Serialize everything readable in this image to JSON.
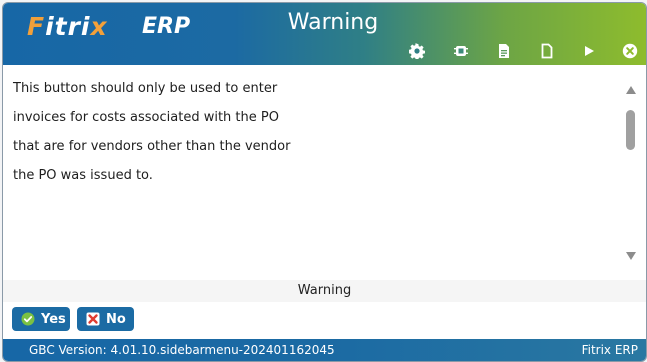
{
  "header": {
    "logo_fitrix": "Fitrix",
    "logo_erp": "ERP",
    "title": "Warning",
    "toolbar": [
      {
        "name": "gear-icon"
      },
      {
        "name": "chip-icon"
      },
      {
        "name": "document-lines-icon"
      },
      {
        "name": "document-icon"
      },
      {
        "name": "play-icon"
      },
      {
        "name": "close-circle-icon"
      }
    ]
  },
  "message": {
    "lines": [
      "This button should only be used to enter",
      "invoices for costs associated with the PO",
      "that are for vendors other than the vendor",
      "the PO was issued to."
    ]
  },
  "status": {
    "label": "Warning"
  },
  "buttons": {
    "yes": "Yes",
    "no": "No"
  },
  "footer": {
    "version": "GBC Version: 4.01.10.sidebarmenu-202401162045",
    "brand": "Fitrix ERP"
  },
  "colors": {
    "header_blue": "#1767a6",
    "header_green": "#8ebc2d",
    "button_blue": "#1b6ba4",
    "yes_check": "#7ac142",
    "no_x": "#e03c31"
  }
}
